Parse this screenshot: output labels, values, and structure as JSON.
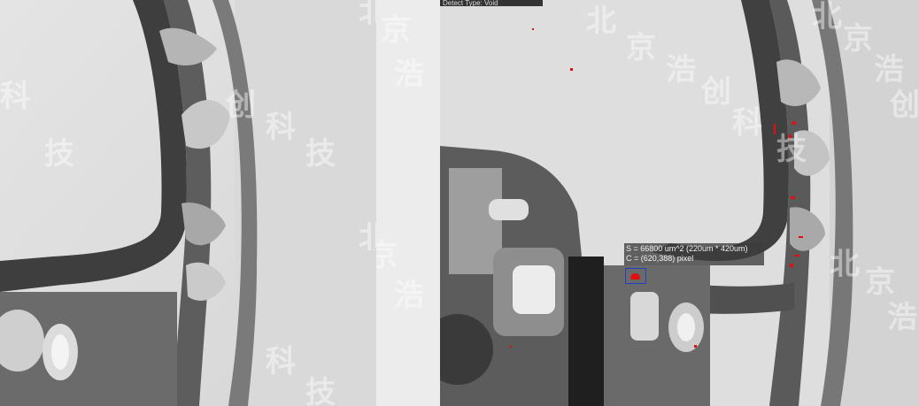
{
  "inspection": {
    "defect_type": "Detect Type: Void",
    "area_readout": "S = 66800 um^2 (220um * 420um)",
    "center_readout": "C = (620,388) pixel",
    "colors": {
      "defect": "#e01010",
      "selection": "#2040c0",
      "background": "#ececec"
    }
  },
  "watermark": {
    "chars": [
      "北",
      "京",
      "浩",
      "创",
      "科",
      "技"
    ]
  }
}
